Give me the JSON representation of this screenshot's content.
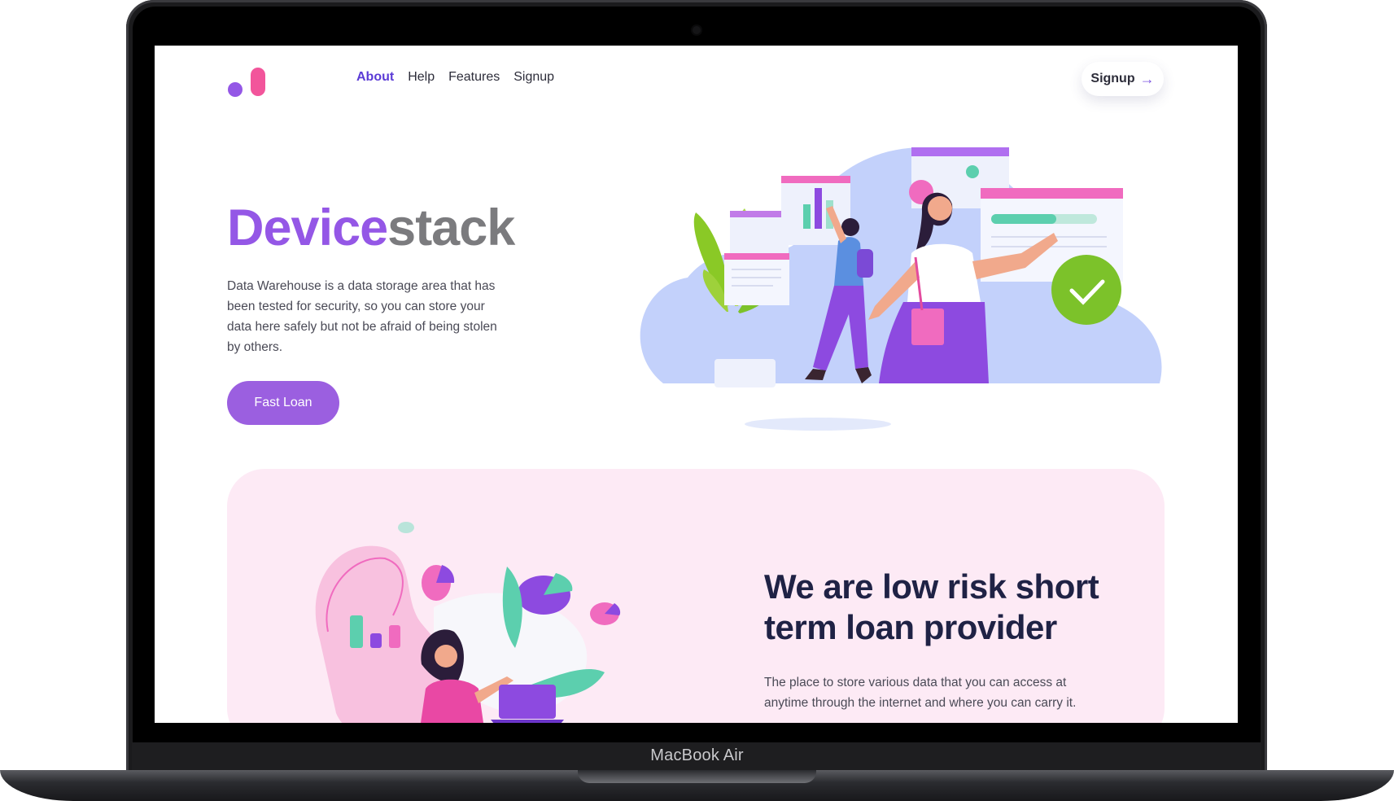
{
  "device": {
    "brand": "MacBook Air"
  },
  "nav": {
    "items": [
      {
        "label": "About",
        "active": true
      },
      {
        "label": "Help",
        "active": false
      },
      {
        "label": "Features",
        "active": false
      },
      {
        "label": "Signup",
        "active": false
      }
    ],
    "signup_button": "Signup",
    "arrow_icon": "arrow-right-icon"
  },
  "hero": {
    "title_part1": "Device",
    "title_part2": "stack",
    "description": "Data Warehouse is a data storage area that has been tested for security, so you can store your data here safely but not be afraid of being stolen by others.",
    "cta_label": "Fast Loan"
  },
  "feature": {
    "title": "We are low risk short term loan provider",
    "description": "The place to store various data that you can access at anytime through the internet and where you can carry it."
  },
  "colors": {
    "accent": "#9457e6",
    "nav_active": "#5b3bd6",
    "button": "#9b5fe0",
    "feature_bg": "#fdeaf5",
    "heading_dark": "#1f2245",
    "check_green": "#7cc22a"
  }
}
